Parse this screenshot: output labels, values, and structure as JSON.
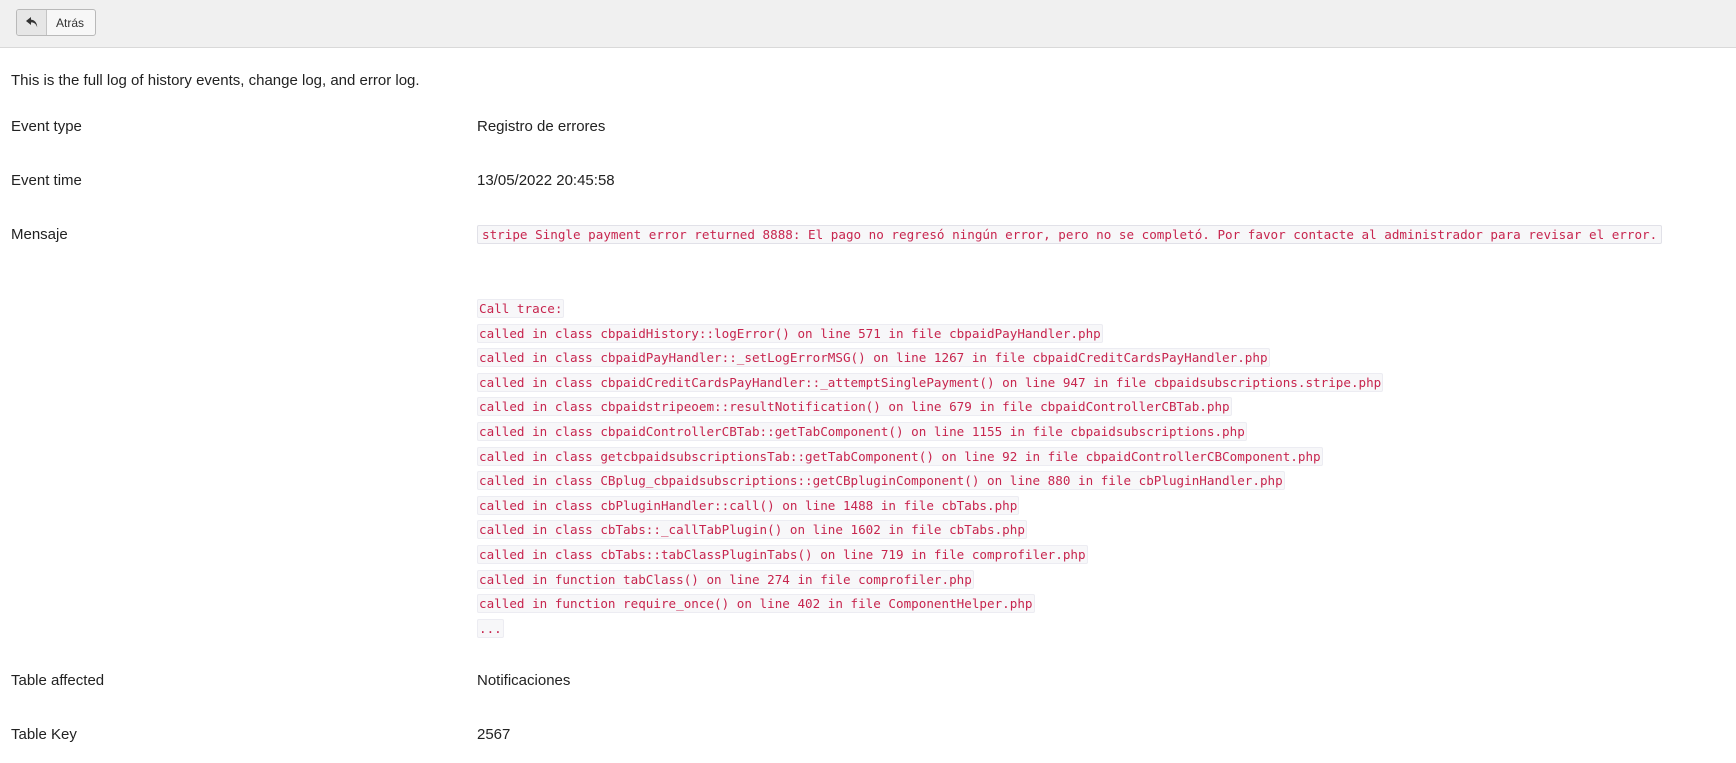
{
  "toolbar": {
    "back_label": "Atrás",
    "back_icon": "undo-arrow-icon"
  },
  "intro": "This is the full log of history events, change log, and error log.",
  "fields": {
    "event_type": {
      "label": "Event type",
      "value": "Registro de errores"
    },
    "event_time": {
      "label": "Event time",
      "value": "13/05/2022 20:45:58"
    },
    "message": {
      "label": "Mensaje",
      "value": "stripe Single payment error returned 8888: El pago no regresó ningún error, pero no se completó. Por favor contacte al administrador para revisar el error."
    },
    "table_affected": {
      "label": "Table affected",
      "value": "Notificaciones"
    },
    "table_key": {
      "label": "Table Key",
      "value": "2567"
    }
  },
  "trace": [
    "Call trace:",
    "called in class cbpaidHistory::logError() on line 571 in file cbpaidPayHandler.php",
    "called in class cbpaidPayHandler::_setLogErrorMSG() on line 1267 in file cbpaidCreditCardsPayHandler.php",
    "called in class cbpaidCreditCardsPayHandler::_attemptSinglePayment() on line 947 in file cbpaidsubscriptions.stripe.php",
    "called in class cbpaidstripeoem::resultNotification() on line 679 in file cbpaidControllerCBTab.php",
    "called in class cbpaidControllerCBTab::getTabComponent() on line 1155 in file cbpaidsubscriptions.php",
    "called in class getcbpaidsubscriptionsTab::getTabComponent() on line 92 in file cbpaidControllerCBComponent.php",
    "called in class CBplug_cbpaidsubscriptions::getCBpluginComponent() on line 880 in file cbPluginHandler.php",
    "called in class cbPluginHandler::call() on line 1488 in file cbTabs.php",
    "called in class cbTabs::_callTabPlugin() on line 1602 in file cbTabs.php",
    "called in class cbTabs::tabClassPluginTabs() on line 719 in file comprofiler.php",
    "called in function tabClass() on line 274 in file comprofiler.php",
    "called in function require_once() on line 402 in file ComponentHelper.php",
    "..."
  ]
}
